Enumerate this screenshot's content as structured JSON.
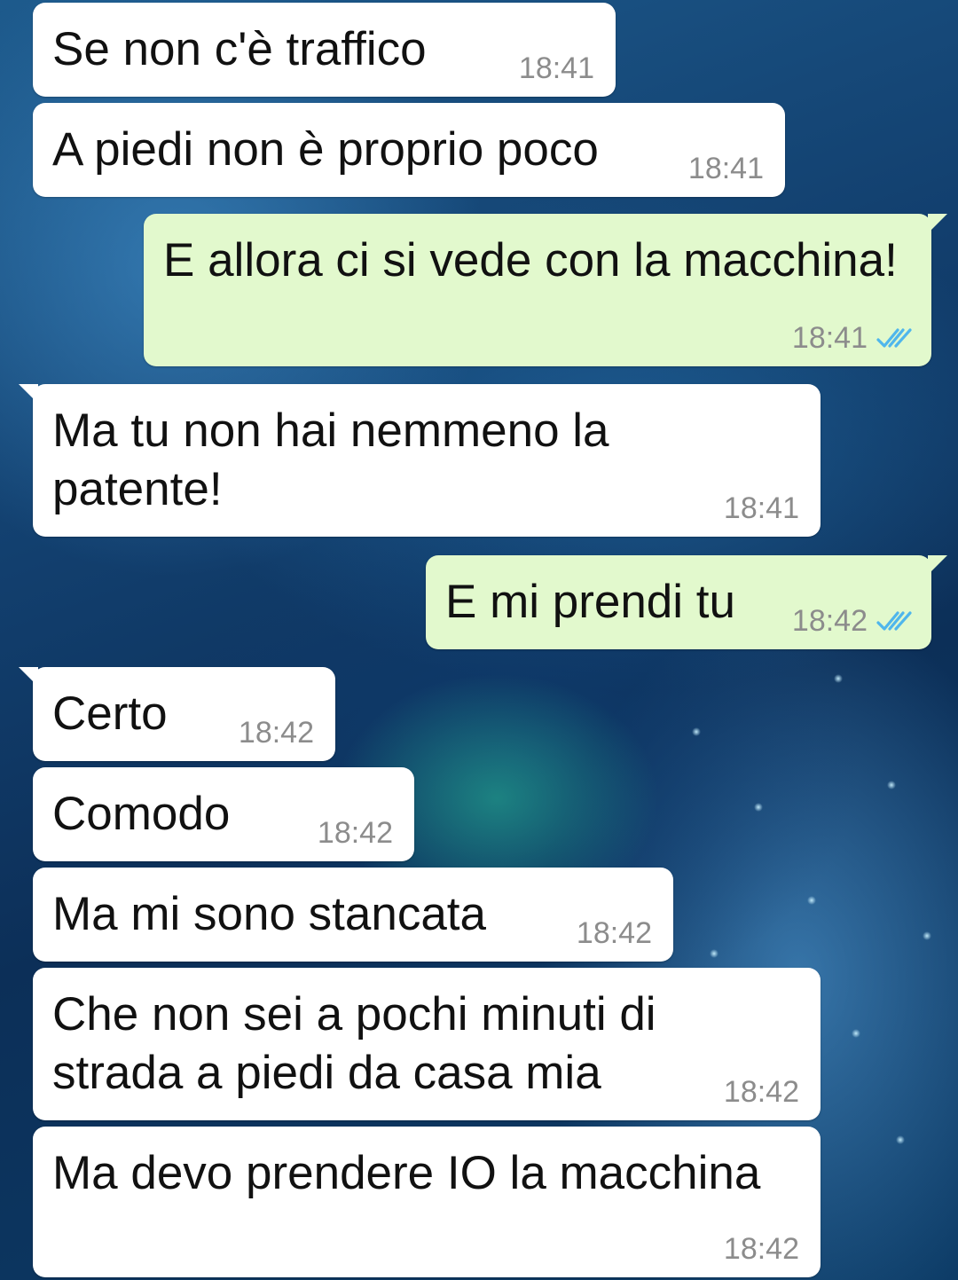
{
  "conversation": {
    "messages": [
      {
        "direction": "incoming",
        "text": "Se non c'è traffico",
        "time": "18:41"
      },
      {
        "direction": "incoming",
        "text": "A piedi non è proprio poco",
        "time": "18:41"
      },
      {
        "direction": "outgoing",
        "text": "E allora ci si vede con la macchina!",
        "time": "18:41",
        "status_icon": "double-check-read-icon"
      },
      {
        "direction": "incoming",
        "text": "Ma tu non hai nemmeno la\npatente!",
        "time": "18:41"
      },
      {
        "direction": "outgoing",
        "text": "E mi prendi tu",
        "time": "18:42",
        "status_icon": "double-check-read-icon"
      },
      {
        "direction": "incoming",
        "text": "Certo",
        "time": "18:42"
      },
      {
        "direction": "incoming",
        "text": "Comodo",
        "time": "18:42"
      },
      {
        "direction": "incoming",
        "text": "Ma mi sono stancata",
        "time": "18:42"
      },
      {
        "direction": "incoming",
        "text": "Che non sei a pochi minuti di\nstrada a piedi da casa mia",
        "time": "18:42"
      },
      {
        "direction": "incoming",
        "text": "Ma devo prendere IO la macchina",
        "time": "18:42"
      }
    ]
  },
  "colors": {
    "incoming_bubble": "#ffffff",
    "outgoing_bubble": "#e2f9cd",
    "timestamp": "#8c8c8c",
    "read_ticks": "#4fb6ec"
  }
}
